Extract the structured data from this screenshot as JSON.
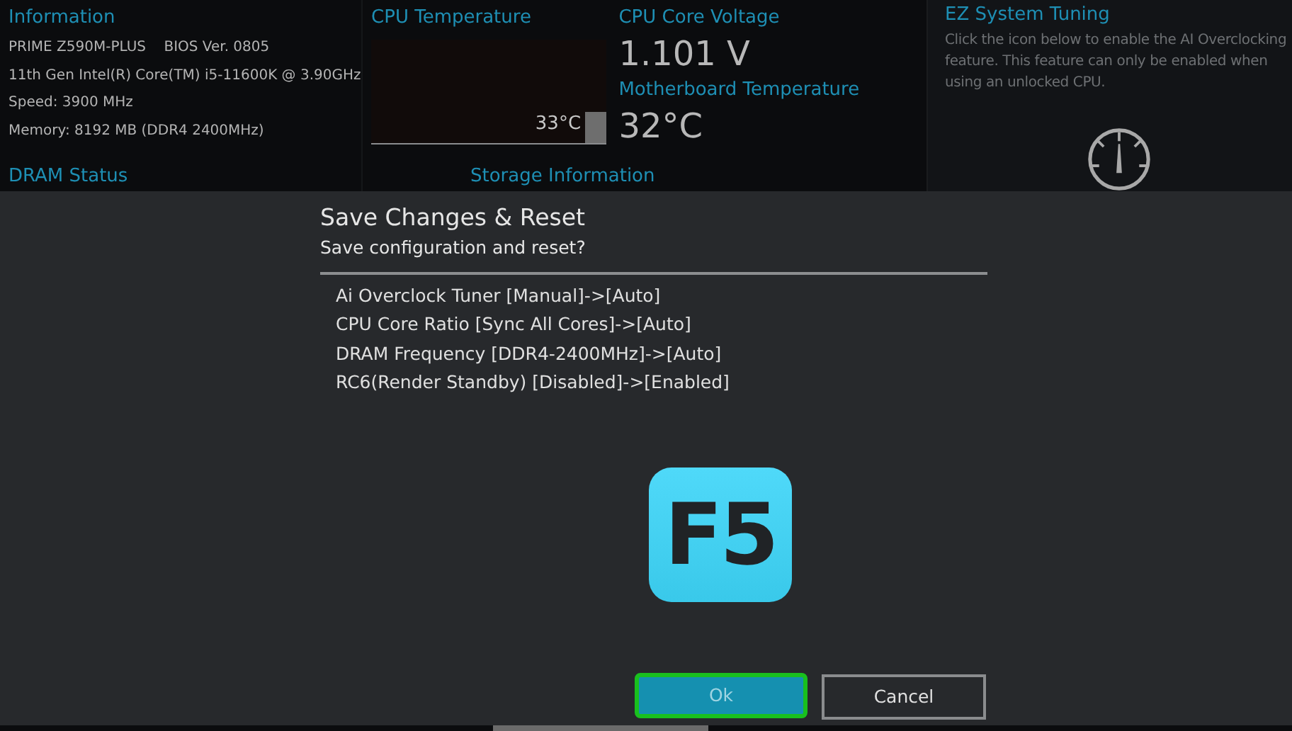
{
  "information": {
    "title": "Information",
    "lines": [
      "PRIME Z590M-PLUS    BIOS Ver. 0805",
      "11th Gen Intel(R) Core(TM) i5-11600K @ 3.90GHz",
      "Speed: 3900 MHz",
      "Memory: 8192 MB (DDR4 2400MHz)"
    ]
  },
  "cpu_temperature": {
    "title": "CPU Temperature",
    "reading": "33°C"
  },
  "cpu_core_voltage": {
    "title": "CPU Core Voltage",
    "value": "1.101 V"
  },
  "motherboard_temperature": {
    "title": "Motherboard Temperature",
    "value": "32°C"
  },
  "ez_system_tuning": {
    "title": "EZ System Tuning",
    "description": "Click the icon below to enable the AI Overclocking feature.  This feature can only be enabled when using an unlocked CPU."
  },
  "lower_sections": [
    "DRAM Status",
    "Storage Information"
  ],
  "dialog": {
    "title": "Save Changes & Reset",
    "subtitle": "Save configuration and reset?",
    "changes": [
      "Ai Overclock Tuner [Manual]->[Auto]",
      "CPU Core Ratio [Sync All Cores]->[Auto]",
      "DRAM Frequency [DDR4-2400MHz]->[Auto]",
      "RC6(Render Standby) [Disabled]->[Enabled]"
    ],
    "key": "F5",
    "buttons": [
      {
        "label": "Ok",
        "selected": true
      },
      {
        "label": "Cancel",
        "selected": false
      }
    ]
  }
}
